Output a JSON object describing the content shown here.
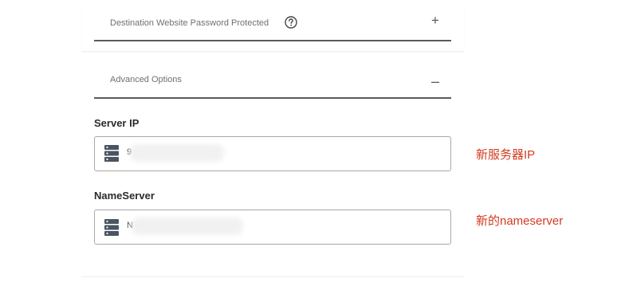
{
  "accordions": [
    {
      "title": "Destination Website Password Protected",
      "toggle": "+"
    },
    {
      "title": "Advanced Options",
      "toggle": "–"
    }
  ],
  "server_ip": {
    "label": "Server IP",
    "value": "9"
  },
  "nameserver": {
    "label": "NameServer",
    "value": "N"
  },
  "annotations": {
    "server_ip_note": "新服务器IP",
    "nameserver_note": "新的nameserver"
  },
  "icons": {
    "help": "question-circle-icon",
    "server": "server-stack-icon"
  },
  "colors": {
    "annotation": "#d23a1f",
    "divider": "#5a5a5a",
    "field_border": "#a8a8a8"
  }
}
